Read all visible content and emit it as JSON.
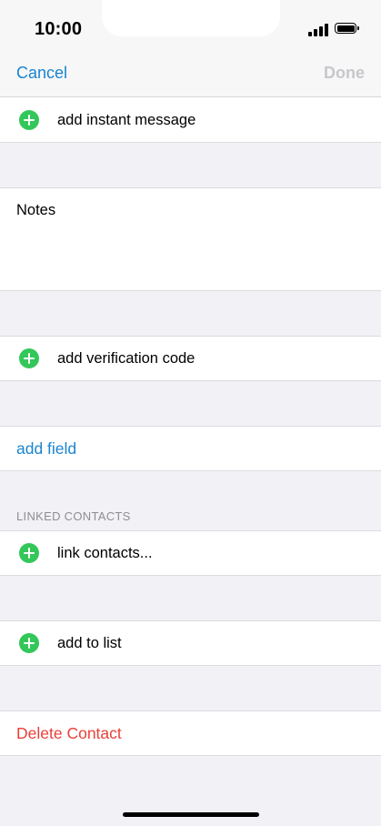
{
  "status_bar": {
    "time": "10:00"
  },
  "nav": {
    "cancel_label": "Cancel",
    "done_label": "Done"
  },
  "rows": {
    "add_instant_message": "add instant message",
    "notes_label": "Notes",
    "add_verification_code": "add verification code",
    "add_field": "add field",
    "linked_contacts_header": "LINKED CONTACTS",
    "link_contacts": "link contacts...",
    "add_to_list": "add to list",
    "delete_contact": "Delete Contact"
  },
  "colors": {
    "accent_blue": "#1a84d0",
    "destructive_red": "#e8413a",
    "add_green": "#33c759",
    "background": "#f2f2f6"
  }
}
